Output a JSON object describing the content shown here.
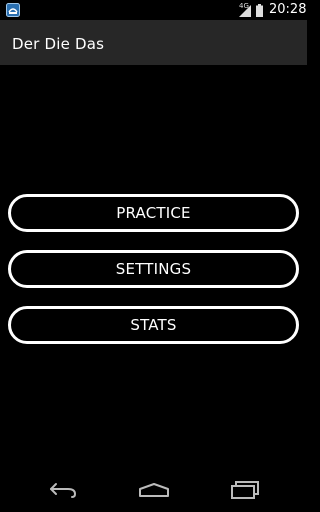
{
  "status_bar": {
    "network": "4G",
    "time": "20:28",
    "icons": [
      "notification-icon",
      "signal-icon",
      "battery-icon"
    ]
  },
  "action_bar": {
    "title": "Der Die Das"
  },
  "menu": {
    "practice_label": "PRACTICE",
    "settings_label": "SETTINGS",
    "stats_label": "STATS"
  },
  "nav_bar": {
    "icons": [
      "back-icon",
      "home-icon",
      "recent-apps-icon"
    ]
  },
  "colors": {
    "background": "#000000",
    "action_bar": "#272727",
    "button_border": "#ffffff",
    "text": "#ffffff"
  }
}
